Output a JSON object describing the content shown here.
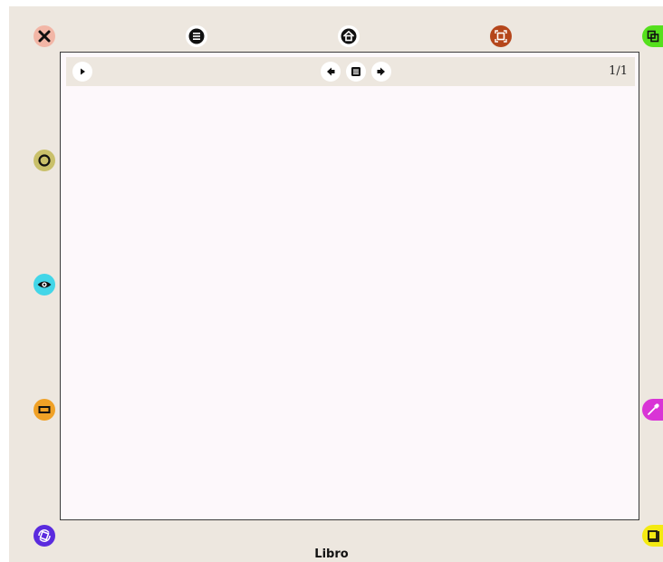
{
  "window": {
    "title": "Libro"
  },
  "toolbar": {
    "page_counter": "1/1"
  },
  "icons": {
    "close": "close-icon",
    "menu": "menu-icon",
    "home": "home-icon",
    "resize": "resize-icon",
    "copy": "copy-icon",
    "circle": "circle-icon",
    "eye": "eye-icon",
    "rectangle": "rectangle-icon",
    "rotate": "rotate-icon",
    "color_picker": "color-picker-icon",
    "shadow_box": "shadow-box-icon",
    "play": "play-icon",
    "prev": "arrow-left-icon",
    "page_list": "page-list-icon",
    "next": "arrow-right-icon"
  },
  "colors": {
    "frame_bg": "#ede7df",
    "canvas_bg": "#fdf8fb",
    "close": "#f2b6a6",
    "resize": "#b5461b",
    "copy": "#55e01d",
    "circle": "#c9c06a",
    "eye": "#43d6e8",
    "rectangle": "#f0a126",
    "rotate": "#5a2bde",
    "color_picker": "#d934d6",
    "shadow_box": "#f4ea12"
  }
}
